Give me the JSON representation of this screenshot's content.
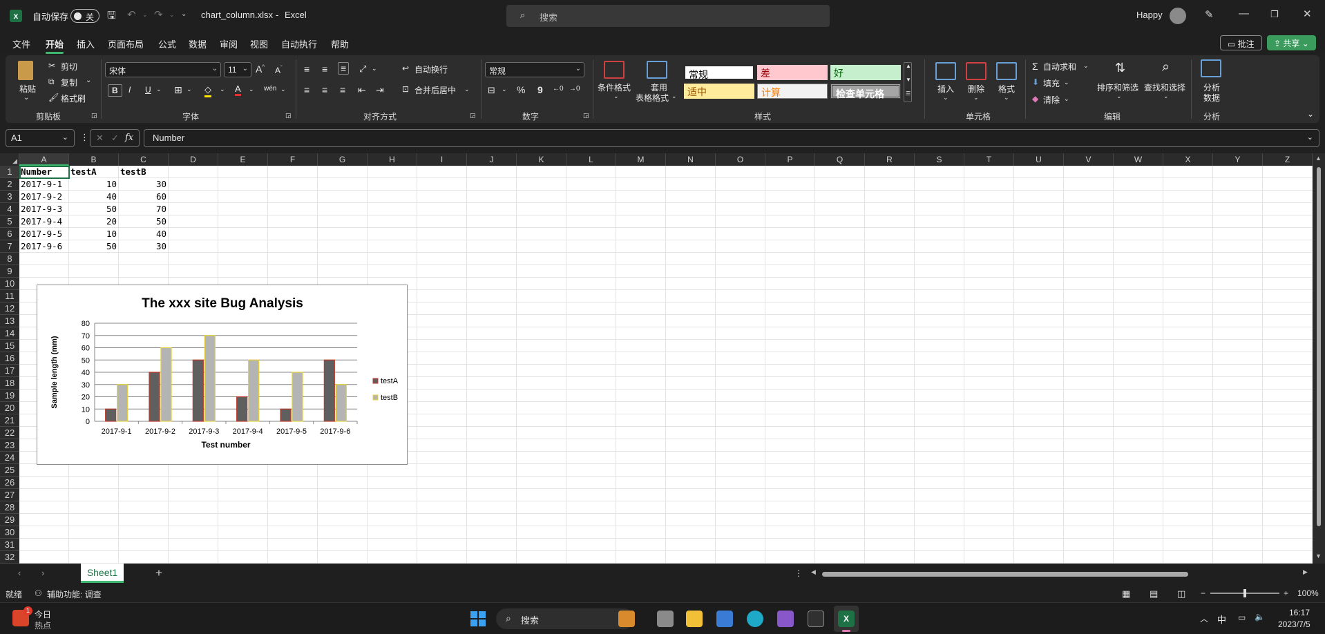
{
  "titlebar": {
    "autosave_label": "自动保存",
    "autosave_state": "关",
    "filename": "chart_column.xlsx",
    "separator": "-",
    "app": "Excel",
    "search_placeholder": "搜索",
    "user": "Happy"
  },
  "menu": {
    "items": [
      "文件",
      "开始",
      "插入",
      "页面布局",
      "公式",
      "数据",
      "审阅",
      "视图",
      "自动执行",
      "帮助"
    ],
    "comments": "批注",
    "share": "共享"
  },
  "ribbon": {
    "clipboard": {
      "paste": "粘贴",
      "cut": "剪切",
      "copy": "复制",
      "format_painter": "格式刷",
      "label": "剪贴板"
    },
    "font": {
      "name": "宋体",
      "size": "11",
      "bold": "B",
      "italic": "I",
      "underline": "U",
      "label": "字体"
    },
    "alignment": {
      "wrap": "自动换行",
      "merge": "合并后居中",
      "label": "对齐方式"
    },
    "number": {
      "format": "常规",
      "percent": "%",
      "comma": "9",
      "label": "数字"
    },
    "styles": {
      "conditional": "条件格式",
      "table_line1": "套用",
      "table_line2": "表格格式",
      "cells": [
        "常规",
        "差",
        "好",
        "适中",
        "计算",
        "检查单元格"
      ],
      "label": "样式"
    },
    "cells": {
      "insert": "插入",
      "delete": "删除",
      "format": "格式",
      "label": "单元格"
    },
    "editing": {
      "autosum": "自动求和",
      "fill": "填充",
      "clear": "清除",
      "sort": "排序和筛选",
      "find": "查找和选择",
      "label": "编辑"
    },
    "analysis": {
      "analyze_line1": "分析",
      "analyze_line2": "数据",
      "label": "分析"
    }
  },
  "formula_bar": {
    "name_box": "A1",
    "fx": "fx",
    "content": "Number"
  },
  "grid": {
    "columns": [
      "A",
      "B",
      "C",
      "D",
      "E",
      "F",
      "G",
      "H",
      "I",
      "J",
      "K",
      "L",
      "M",
      "N",
      "O",
      "P",
      "Q",
      "R",
      "S",
      "T",
      "U",
      "V",
      "W",
      "X",
      "Y",
      "Z"
    ],
    "rows": [
      "1",
      "2",
      "3",
      "4",
      "5",
      "6",
      "7",
      "8",
      "9",
      "10",
      "11",
      "12",
      "13",
      "14",
      "15",
      "16",
      "17",
      "18",
      "19",
      "20",
      "21",
      "22",
      "23",
      "24",
      "25",
      "26",
      "27",
      "28",
      "29",
      "30",
      "31",
      "32"
    ],
    "header": [
      "Number",
      "testA",
      "testB"
    ],
    "data": [
      [
        "2017-9-1",
        "10",
        "30"
      ],
      [
        "2017-9-2",
        "40",
        "60"
      ],
      [
        "2017-9-3",
        "50",
        "70"
      ],
      [
        "2017-9-4",
        "20",
        "50"
      ],
      [
        "2017-9-5",
        "10",
        "40"
      ],
      [
        "2017-9-6",
        "50",
        "30"
      ]
    ]
  },
  "chart_data": {
    "type": "bar",
    "title": "The xxx site Bug Analysis",
    "xlabel": "Test number",
    "ylabel": "Sample length (mm)",
    "categories": [
      "2017-9-1",
      "2017-9-2",
      "2017-9-3",
      "2017-9-4",
      "2017-9-5",
      "2017-9-6"
    ],
    "series": [
      {
        "name": "testA",
        "values": [
          10,
          40,
          50,
          20,
          10,
          50
        ],
        "fill": "#5f5f5f",
        "stroke": "#c0392b"
      },
      {
        "name": "testB",
        "values": [
          30,
          60,
          70,
          50,
          40,
          30
        ],
        "fill": "#b4b4b4",
        "stroke": "#e5d23c"
      }
    ],
    "ylim": [
      0,
      80
    ],
    "yticks": [
      "0",
      "10",
      "20",
      "30",
      "40",
      "50",
      "60",
      "70",
      "80"
    ],
    "grid": true,
    "legend": "right"
  },
  "sheet_tabs": {
    "active": "Sheet1",
    "add": "+"
  },
  "statusbar": {
    "ready": "就绪",
    "accessibility": "辅助功能: 调查",
    "zoom": "100%"
  },
  "taskbar": {
    "weather_title": "今日",
    "weather_sub": "热点",
    "badge": "1",
    "search": "搜索",
    "lang": "中",
    "time": "16:17",
    "date": "2023/7/5"
  }
}
